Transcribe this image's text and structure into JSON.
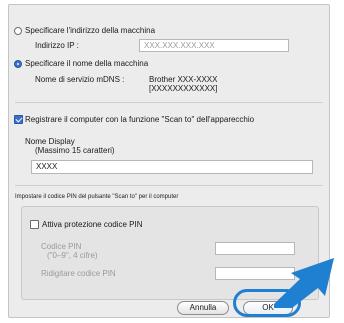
{
  "address": {
    "option_ip_label": "Specificare l'indirizzo della macchina",
    "ip_label": "Indirizzo IP :",
    "ip_placeholder": "XXX.XXX.XXX.XXX",
    "option_name_label": "Specificare il nome della macchina",
    "mdns_label": "Nome di servizio mDNS :",
    "mdns_value_line1": "Brother XXX-XXXX",
    "mdns_value_line2": "[XXXXXXXXXXXX]"
  },
  "scan_to": {
    "checkbox_label": "Registrare il computer con la funzione \"Scan to\" dell'apparecchio",
    "checked": true,
    "display_name_label": "Nome Display",
    "display_name_hint": "(Massimo 15 caratteri)",
    "display_name_value": "XXXX"
  },
  "pin": {
    "section_label": "Impostare il codice PIN del pulsante \"Scan to\" per il computer",
    "enable_label": "Attiva protezione codice PIN",
    "pin_label": "Codice PIN",
    "pin_hint": "(\"0–9\", 4 cifre)",
    "confirm_label": "Ridigitare codice PIN"
  },
  "buttons": {
    "cancel_label": "Annulla",
    "ok_label": "OK"
  },
  "colors": {
    "accent": "#3a6fcf",
    "pointer_arrow": "#1f7fd0",
    "highlight": "#1f7fd0"
  }
}
